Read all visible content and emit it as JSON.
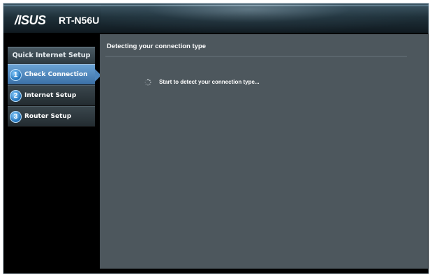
{
  "header": {
    "logo_text": "/ISUS",
    "model": "RT-N56U"
  },
  "sidebar": {
    "title": "Quick Internet Setup",
    "steps": [
      {
        "number": "1",
        "label": "Check Connection",
        "active": true
      },
      {
        "number": "2",
        "label": "Internet Setup",
        "active": false
      },
      {
        "number": "3",
        "label": "Router Setup",
        "active": false
      }
    ]
  },
  "main": {
    "title": "Detecting your connection type",
    "status_text": "Start to detect your connection type..."
  },
  "colors": {
    "active_step": "#4e86bd",
    "panel_bg": "#4d575d",
    "frame_bg": "#000000"
  }
}
